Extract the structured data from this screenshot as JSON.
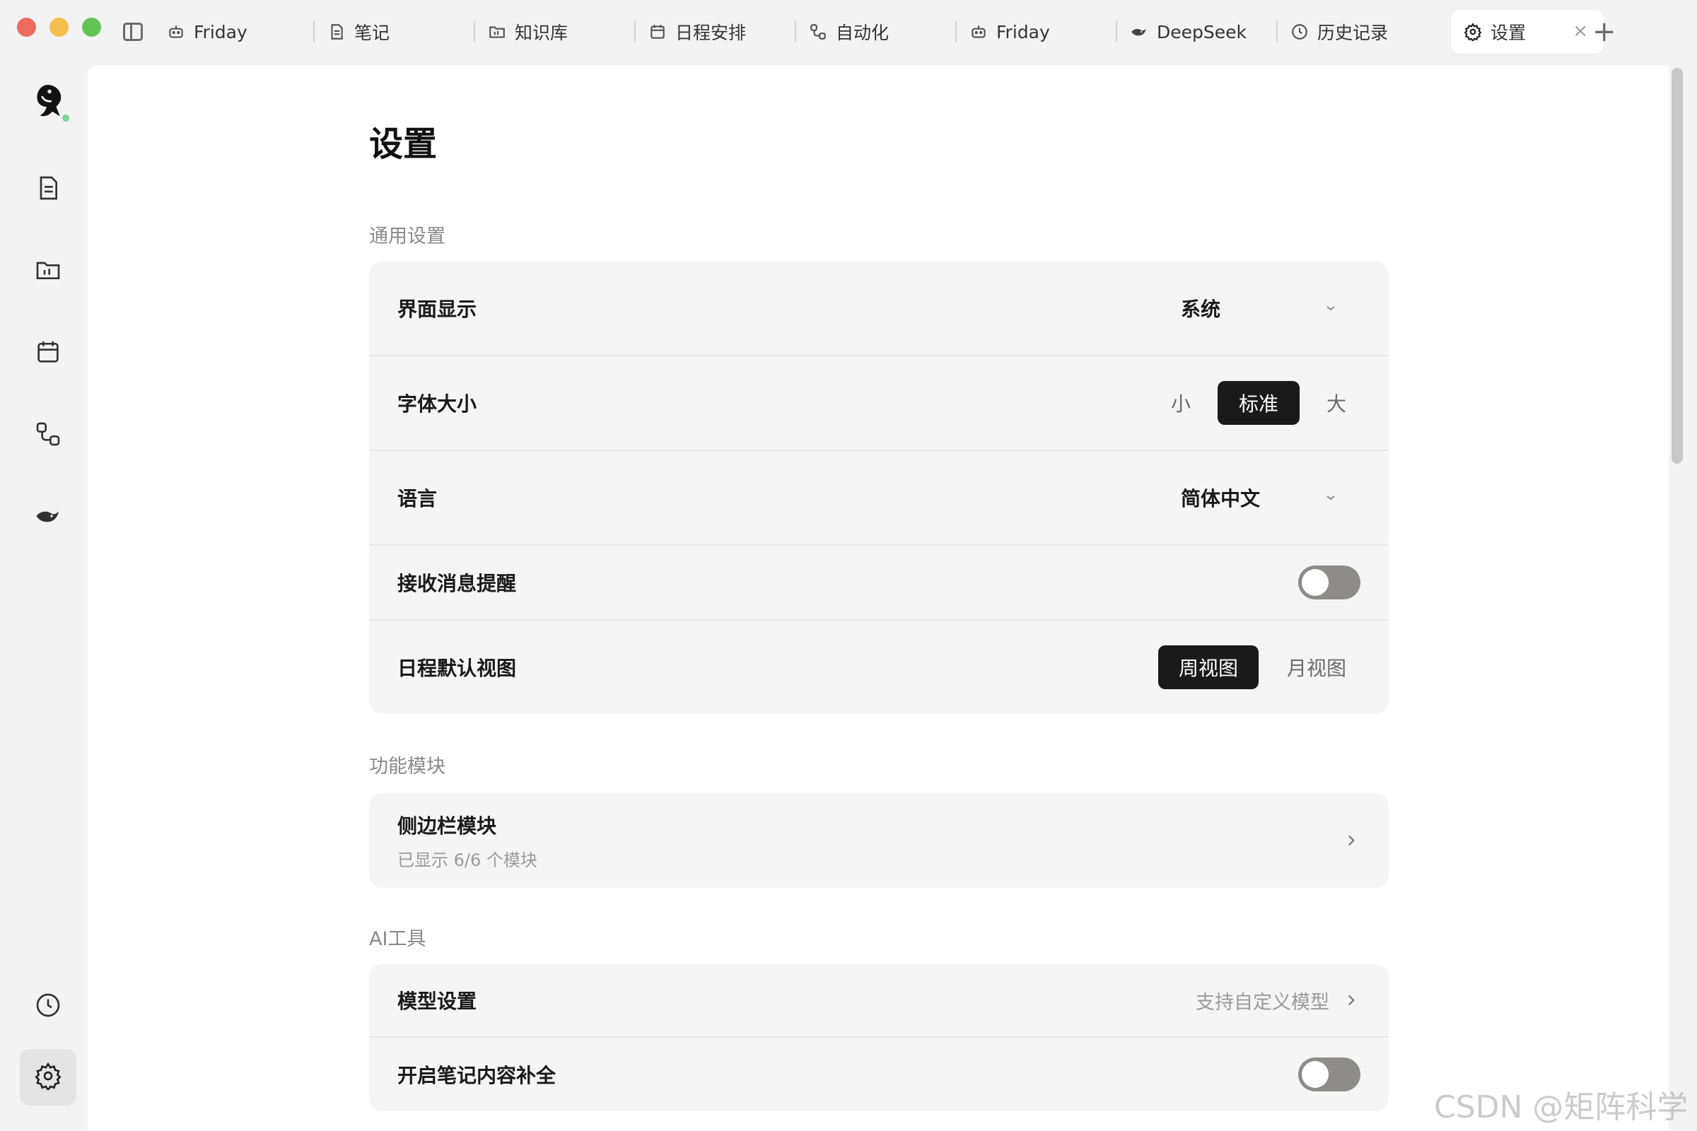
{
  "tabs": [
    {
      "label": "Friday",
      "icon": "robot-icon"
    },
    {
      "label": "笔记",
      "icon": "document-icon"
    },
    {
      "label": "知识库",
      "icon": "folder-chart-icon"
    },
    {
      "label": "日程安排",
      "icon": "calendar-icon"
    },
    {
      "label": "自动化",
      "icon": "workflow-icon"
    },
    {
      "label": "Friday",
      "icon": "robot-icon"
    },
    {
      "label": "DeepSeek",
      "icon": "whale-icon"
    },
    {
      "label": "历史记录",
      "icon": "clock-icon"
    },
    {
      "label": "设置",
      "icon": "gear-icon",
      "active": true
    }
  ],
  "new_tab_glyph": "+",
  "close_glyph": "×",
  "page": {
    "title": "设置"
  },
  "general": {
    "section_label": "通用设置",
    "display": {
      "label": "界面显示",
      "value": "系统"
    },
    "font_size": {
      "label": "字体大小",
      "options": [
        "小",
        "标准",
        "大"
      ],
      "selected": "标准"
    },
    "language": {
      "label": "语言",
      "value": "简体中文"
    },
    "notifications": {
      "label": "接收消息提醒",
      "enabled": false
    },
    "schedule_view": {
      "label": "日程默认视图",
      "options": [
        "周视图",
        "月视图"
      ],
      "selected": "周视图"
    }
  },
  "modules": {
    "section_label": "功能模块",
    "sidebar": {
      "label": "侧边栏模块",
      "sub": "已显示 6/6 个模块"
    }
  },
  "ai_tools": {
    "section_label": "AI工具",
    "model": {
      "label": "模型设置",
      "hint": "支持自定义模型"
    },
    "completion": {
      "label": "开启笔记内容补全",
      "enabled": false
    }
  },
  "watermark": "CSDN @矩阵科学",
  "colors": {
    "accent": "#1a1a1a",
    "card_bg": "#f5f5f5",
    "toggle_off": "#8e8c8a"
  }
}
